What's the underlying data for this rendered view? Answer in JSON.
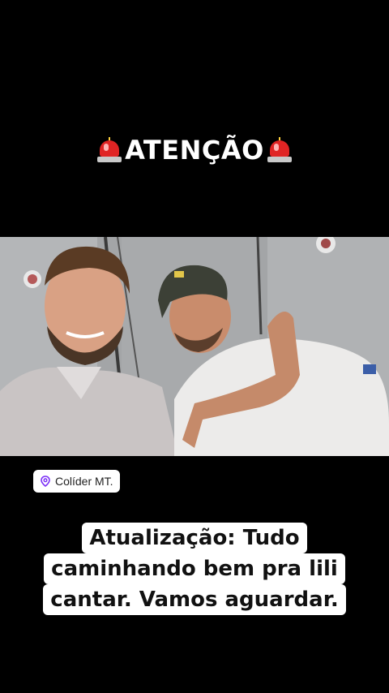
{
  "header": {
    "title": "ATENÇÃO",
    "left_icon": "police-siren-icon",
    "right_icon": "police-siren-icon"
  },
  "location_sticker": {
    "icon": "location-pin-icon",
    "label": "Colíder MT."
  },
  "caption": {
    "lines": [
      "Atualização: Tudo",
      "caminhando bem pra lili",
      "cantar. Vamos aguardar."
    ]
  },
  "colors": {
    "background": "#000000",
    "siren_red": "#e02424",
    "pin_purple": "#7b2ff7"
  }
}
